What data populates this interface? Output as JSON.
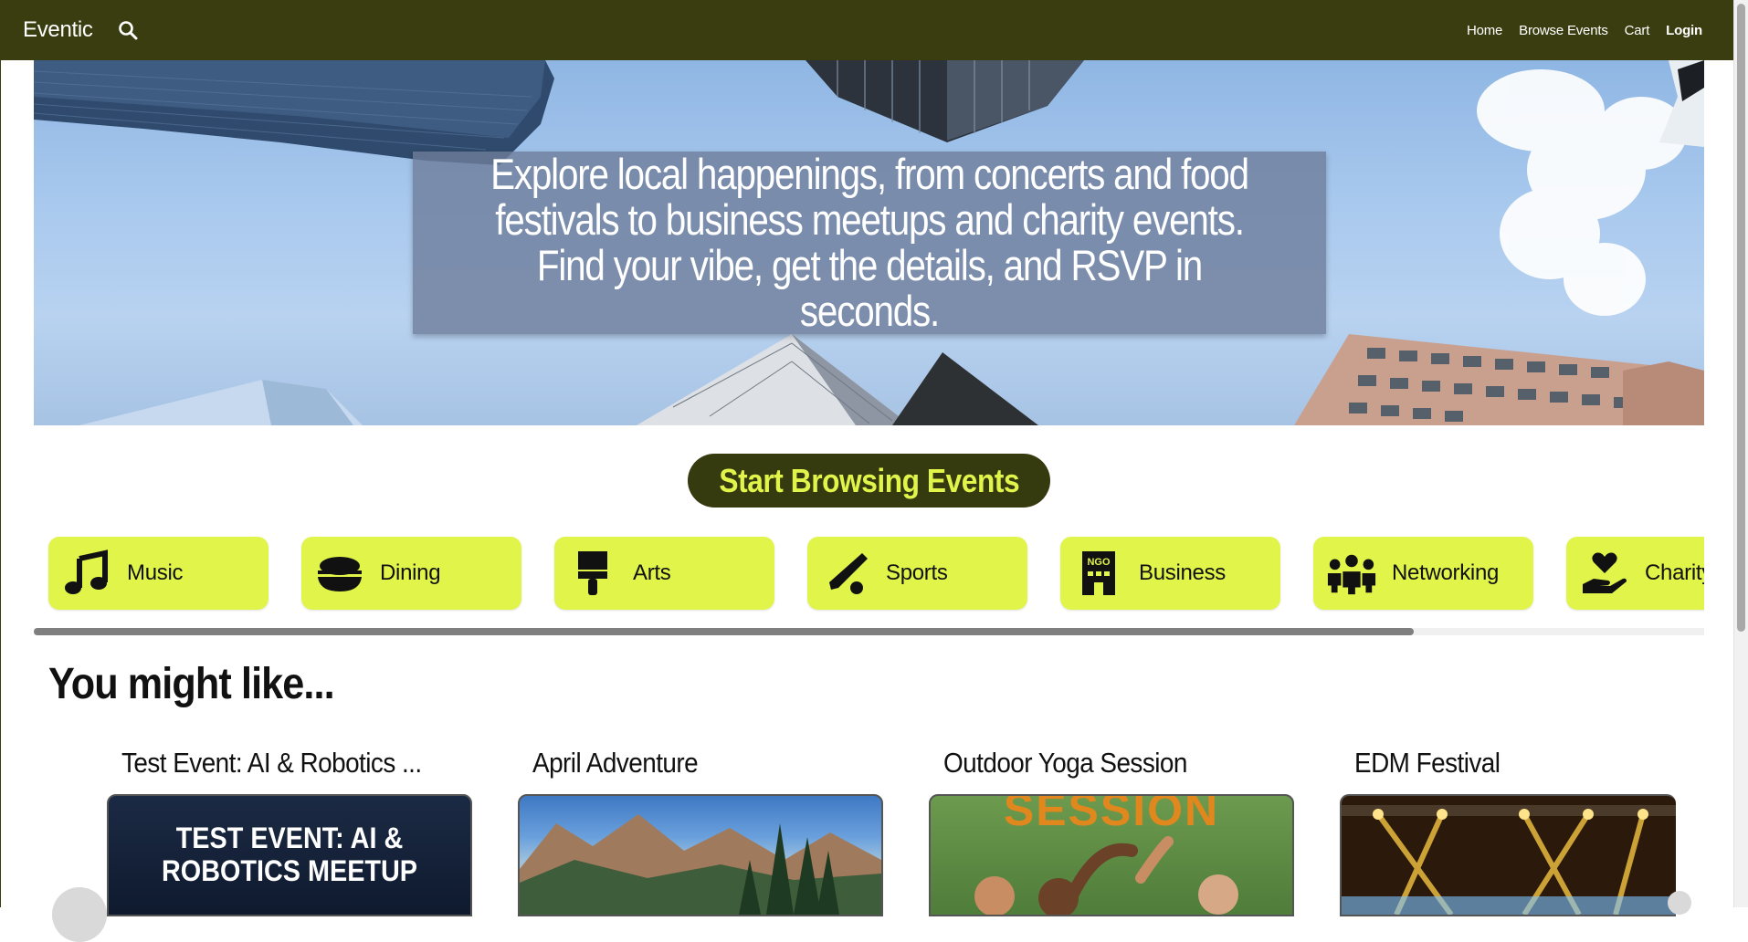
{
  "navbar": {
    "brand": "Eventic",
    "links": [
      "Home",
      "Browse Events",
      "Cart",
      "Login"
    ],
    "bg_color": "#3a3d10"
  },
  "hero": {
    "text": "Explore local happenings, from concerts and food festivals to business meetups and charity events. Find your vibe, get the details, and RSVP in seconds."
  },
  "cta": {
    "label": "Start Browsing Events",
    "text_color": "#e1f44a"
  },
  "categories": [
    {
      "label": "Music",
      "icon": "music-note-icon"
    },
    {
      "label": "Dining",
      "icon": "food-bowl-icon"
    },
    {
      "label": "Arts",
      "icon": "paint-brush-icon"
    },
    {
      "label": "Sports",
      "icon": "baseball-bat-icon"
    },
    {
      "label": "Business",
      "icon": "building-ngo-icon"
    },
    {
      "label": "Networking",
      "icon": "people-group-icon"
    },
    {
      "label": "Charity",
      "icon": "hand-heart-icon"
    }
  ],
  "recommended": {
    "title": "You might like...",
    "events": [
      {
        "title": "Test Event: AI & Robotics ...",
        "image_text": "TEST EVENT: AI & ROBOTICS MEETUP"
      },
      {
        "title": "April Adventure"
      },
      {
        "title": "Outdoor Yoga Session",
        "image_text": "SESSION"
      },
      {
        "title": "EDM Festival"
      }
    ]
  },
  "colors": {
    "accent": "#e1f44a",
    "dark": "#363a0f"
  }
}
